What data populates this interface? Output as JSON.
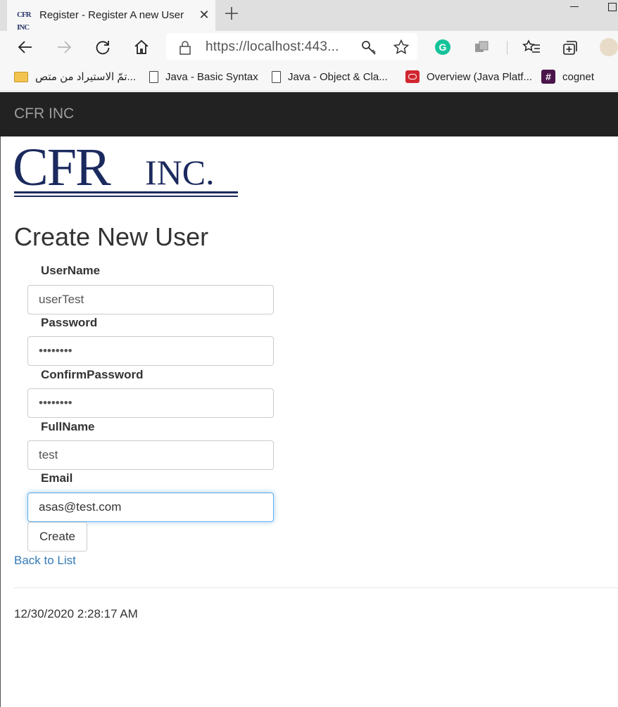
{
  "browser": {
    "tab_title": "Register - Register A new User",
    "tab_favicon_text": "CFR INC",
    "new_tab_icon": "plus-icon",
    "address": "https://localhost:443...",
    "bookmarks": [
      {
        "label": "تمّ الاستيراد من متص...",
        "icon": "folder-icon"
      },
      {
        "label": "Java - Basic Syntax",
        "icon": "page-icon"
      },
      {
        "label": "Java - Object & Cla...",
        "icon": "page-icon"
      },
      {
        "label": "Overview (Java Platf...",
        "icon": "oracle-icon"
      },
      {
        "label": "cognet",
        "icon": "slack-icon"
      }
    ]
  },
  "site": {
    "brand": "CFR INC",
    "logo_text_large": "CFR",
    "logo_text_small": "INC."
  },
  "form": {
    "title": "Create New User",
    "fields": [
      {
        "label": "UserName",
        "value": "userTest",
        "type": "text"
      },
      {
        "label": "Password",
        "value": "••••••••",
        "type": "password"
      },
      {
        "label": "ConfirmPassword",
        "value": "••••••••",
        "type": "password"
      },
      {
        "label": "FullName",
        "value": "test",
        "type": "text"
      },
      {
        "label": "Email",
        "value": "asas@test.com",
        "type": "text",
        "focused": true
      }
    ],
    "submit_label": "Create",
    "back_link": "Back to List"
  },
  "footer": {
    "timestamp": "12/30/2020 2:28:17 AM"
  },
  "colors": {
    "header_bg": "#222222",
    "brand_text": "#9d9d9d",
    "logo_navy": "#1b2a5e",
    "link": "#337ab7",
    "focus_border": "#66afe9"
  }
}
